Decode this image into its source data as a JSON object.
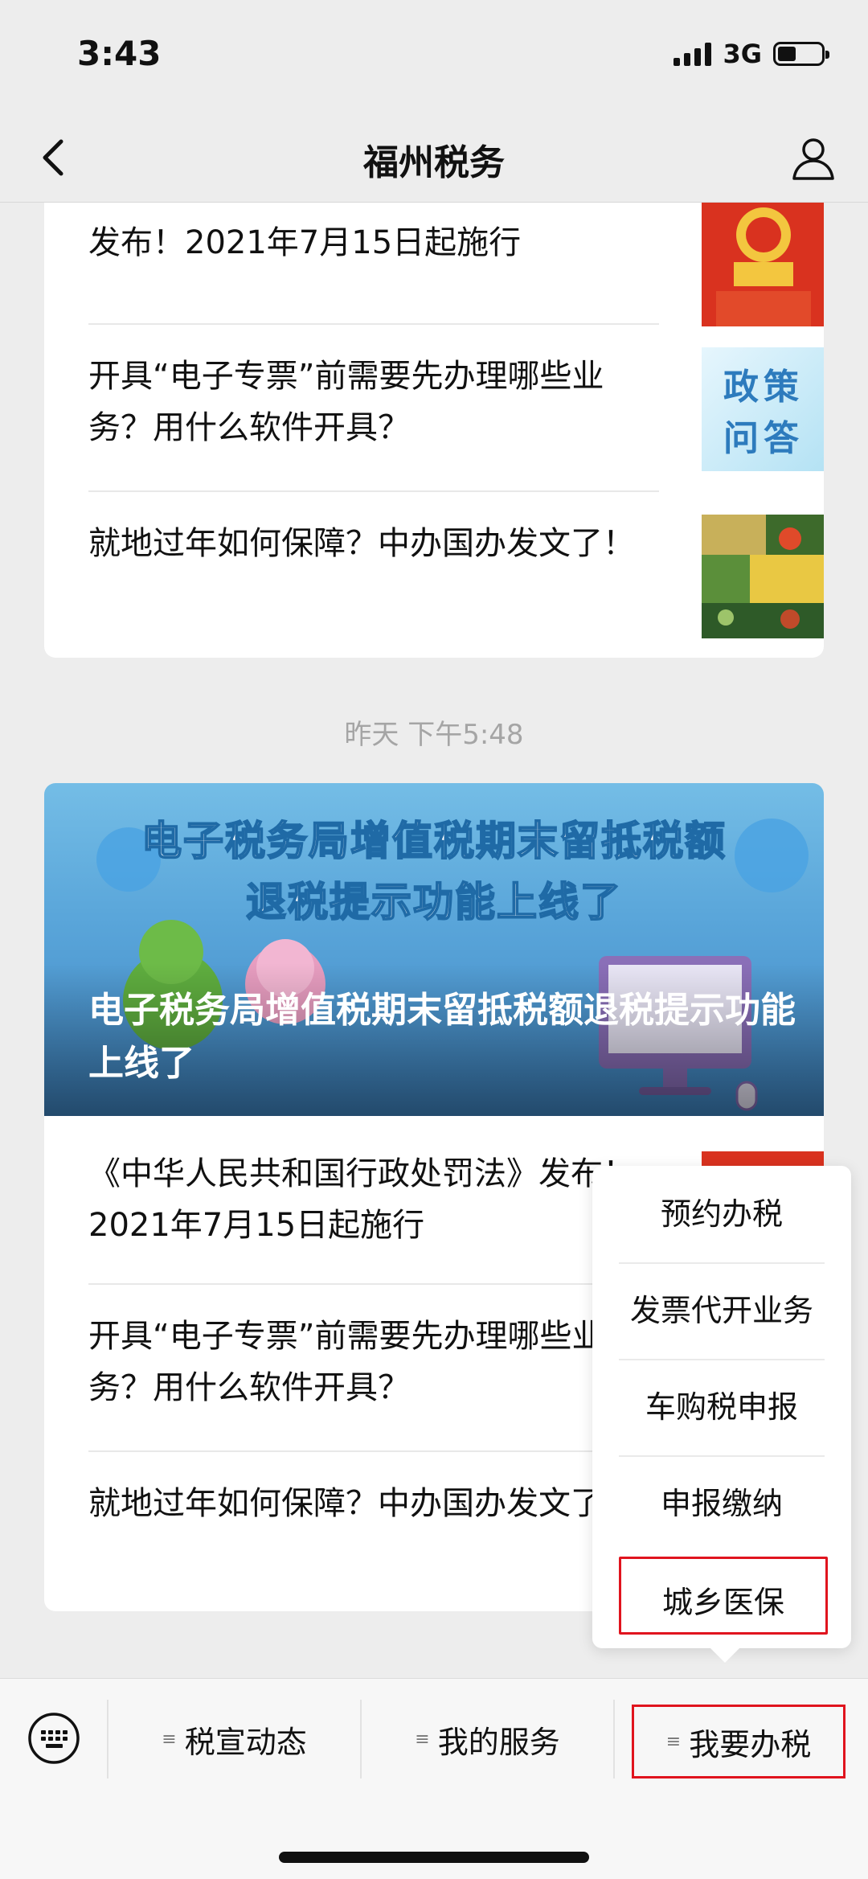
{
  "status_bar": {
    "time": "3:43",
    "network": "3G"
  },
  "nav": {
    "title": "福州税务",
    "back_icon": "back-arrow-icon",
    "user_icon": "user-icon"
  },
  "articles_top": [
    {
      "title": "发布！2021年7月15日起施行",
      "thumb": "national-emblem-thumbnail"
    },
    {
      "title": "开具“电子专票”前需要先办理哪些业务？用什么软件开具？",
      "thumb": "policy-qa-thumbnail",
      "thumb_text_1": "政策",
      "thumb_text_2": "问答"
    },
    {
      "title": "就地过年如何保障？中办国办发文了！",
      "thumb": "vegetables-thumbnail"
    }
  ],
  "timestamp": "昨天 下午5:48",
  "hero": {
    "heading_line1": "电子税务局增值税期末留抵税额",
    "heading_line2": "退税提示功能上线了",
    "caption": "电子税务局增值税期末留抵税额退税提示功能上线了"
  },
  "articles_bottom": [
    {
      "title": "《中华人民共和国行政处罚法》发布！2021年7月15日起施行"
    },
    {
      "title": "开具“电子专票”前需要先办理哪些业务？用什么软件开具？"
    },
    {
      "title": "就地过年如何保障？中办国办发文了！"
    }
  ],
  "popup_menu": {
    "items": [
      "预约办税",
      "发票代开业务",
      "车购税申报",
      "申报缴纳",
      "城乡医保"
    ],
    "highlight_color": "#e0141e"
  },
  "bottom_menu": {
    "tabs": [
      "税宣动态",
      "我的服务",
      "我要办税"
    ],
    "lines_glyph": "≡",
    "keyboard_icon": "keyboard-icon"
  }
}
